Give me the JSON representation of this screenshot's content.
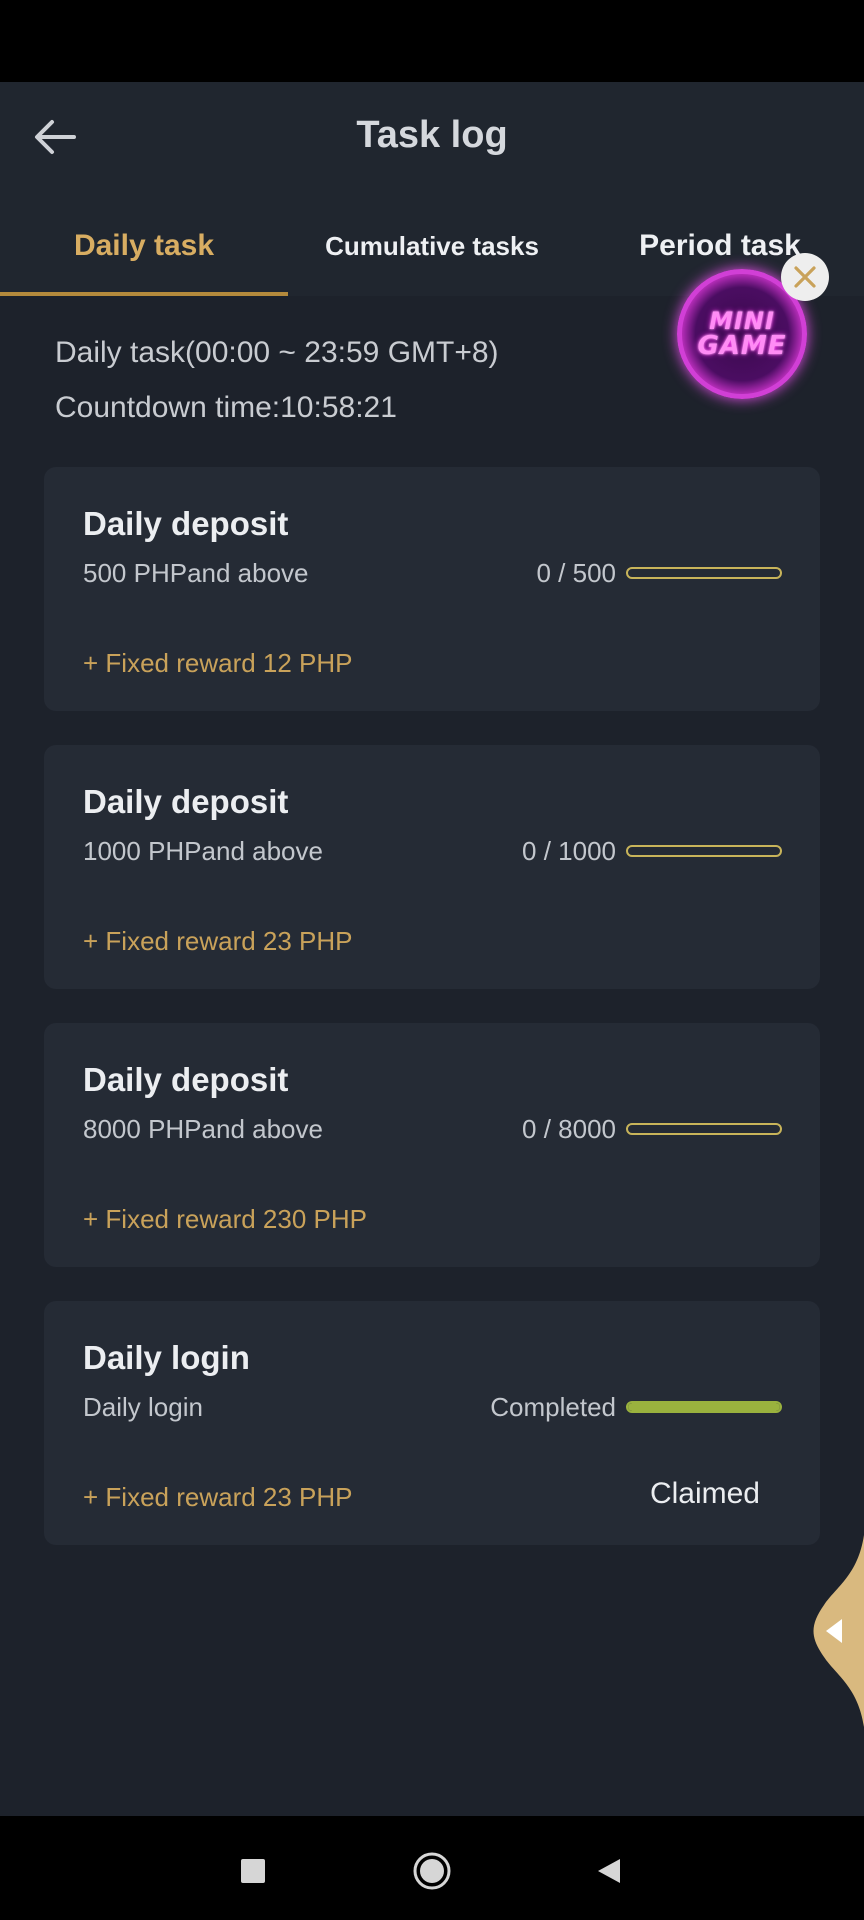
{
  "header": {
    "title": "Task log",
    "tabs": [
      {
        "label": "Daily task",
        "active": true
      },
      {
        "label": "Cumulative tasks",
        "active": false
      },
      {
        "label": "Period task",
        "active": false
      }
    ]
  },
  "info": {
    "range": "Daily task(00:00 ~ 23:59 GMT+8)",
    "countdown": "Countdown time:10:58:21"
  },
  "tasks": [
    {
      "title": "Daily deposit",
      "requirement": "500 PHPand above",
      "progress_text": "0 / 500",
      "progress": 0,
      "reward": "+ Fixed reward 12 PHP",
      "status": ""
    },
    {
      "title": "Daily deposit",
      "requirement": "1000 PHPand above",
      "progress_text": "0 / 1000",
      "progress": 0,
      "reward": "+ Fixed reward 23 PHP",
      "status": ""
    },
    {
      "title": "Daily deposit",
      "requirement": "8000 PHPand above",
      "progress_text": "0 / 8000",
      "progress": 0,
      "reward": "+ Fixed reward 230 PHP",
      "status": ""
    },
    {
      "title": "Daily login",
      "requirement": "Daily login",
      "progress_text": "Completed",
      "progress": 1,
      "reward": "+ Fixed reward 23 PHP",
      "status": "Claimed"
    }
  ],
  "floating": {
    "mini_game_line1": "MINI",
    "mini_game_line2": "GAME"
  },
  "colors": {
    "background": "#1d222b",
    "accent_gold": "#d8ad62",
    "reward_text": "#c9a25a",
    "progress_done": "#9ab23e",
    "card": "#252b35"
  },
  "icons": {
    "back": "arrow-left-icon",
    "close": "close-icon",
    "side_tab": "caret-left-icon",
    "nav_recent": "square-icon",
    "nav_home": "circle-icon",
    "nav_back": "triangle-left-icon"
  }
}
